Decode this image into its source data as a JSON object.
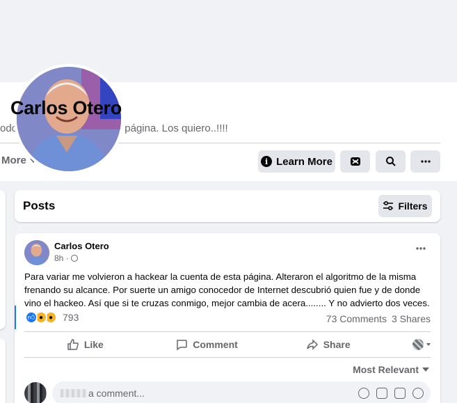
{
  "page": {
    "name": "Carlos Otero",
    "bio": "odos por ser parte de esta página. Los quiero..!!!!"
  },
  "nav": {
    "more_label": "More"
  },
  "actions_bar": {
    "learn_more_label": "Learn More"
  },
  "posts_header": {
    "title": "Posts",
    "filters_label": "Filters"
  },
  "post": {
    "author": "Carlos Otero",
    "time": "8h ·",
    "text": "Para variar me volvieron a hackear la cuenta de esta página. Alteraron el algoritmo de la misma frenando su alcance. Por suerte un amigo conocedor de Internet descubrió quien fue y de donde vino el hackeo. Así que si te cruzas conmigo, mejor cambia de acera........ Y no advierto dos veces.",
    "reaction_count": "793",
    "comments_count": "73 Comments",
    "shares_count": "3 Shares",
    "like_label": "Like",
    "comment_label": "Comment",
    "share_label": "Share",
    "sort_label": "Most Relevant",
    "comment_placeholder": "a comment..."
  },
  "colors": {
    "accent": "#1877f2",
    "background": "#f0f2f5",
    "button_bg": "#e4e6eb",
    "secondary_text": "#65676b"
  },
  "icons": [
    "info-icon",
    "messenger-icon",
    "search-icon",
    "more-dots-icon",
    "filters-icon",
    "globe-icon",
    "like-reaction-icon",
    "wow-reaction-icon",
    "haha-reaction-icon",
    "thumbs-up-icon",
    "comment-icon",
    "share-icon",
    "chevron-down-icon",
    "emoji-icon",
    "camera-icon",
    "gif-icon",
    "sticker-icon"
  ]
}
